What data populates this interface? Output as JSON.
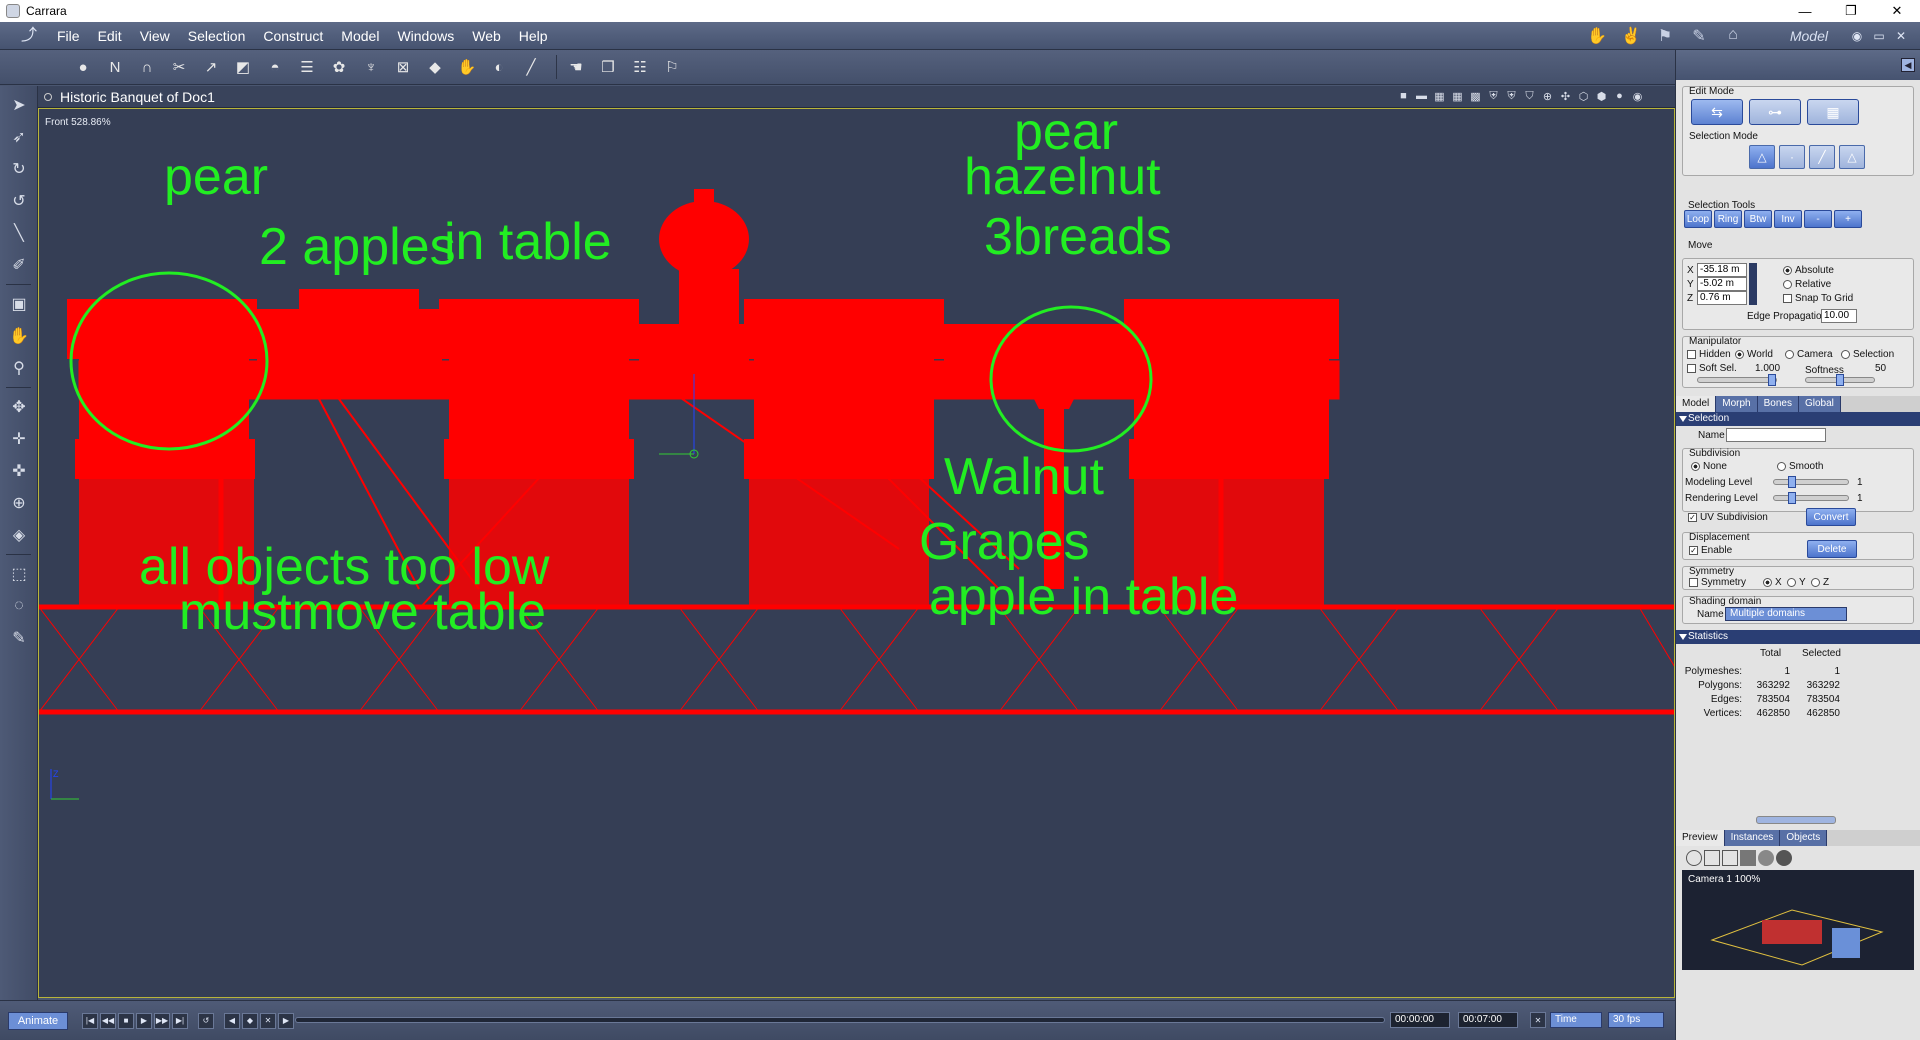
{
  "window": {
    "title": "Carrara",
    "min": "—",
    "restore": "❐",
    "close": "✕"
  },
  "menubar": {
    "items": [
      "File",
      "Edit",
      "View",
      "Selection",
      "Construct",
      "Model",
      "Windows",
      "Web",
      "Help"
    ],
    "room_name": "Model"
  },
  "viewport": {
    "doc_title": "Historic  Banquet of Doc1",
    "camera_label": "Front 528.86%"
  },
  "annotations": {
    "left_top": [
      "pear",
      "2 apples",
      "in table"
    ],
    "left_bottom": [
      "all objects too low",
      "mustmove table"
    ],
    "right_top": [
      "pear",
      "hazelnut",
      "3breads"
    ],
    "right_bottom": [
      "Walnut",
      "Grapes",
      "apple in table"
    ]
  },
  "timeline": {
    "animate_label": "Animate",
    "current_time": "00:00:00",
    "end_time": "00:07:00",
    "time_mode": "Time",
    "fps": "30 fps"
  },
  "panel": {
    "edit_mode_label": "Edit Mode",
    "selection_mode_label": "Selection Mode",
    "selection_tools_label": "Selection Tools",
    "selection_tools": [
      "Loop",
      "Ring",
      "Btw",
      "Inv",
      "-",
      "+"
    ],
    "move_label": "Move",
    "x_label": "X",
    "x_value": "-35.18 m",
    "y_label": "Y",
    "y_value": "-5.02 m",
    "z_label": "Z",
    "z_value": "0.76 m",
    "absolute": "Absolute",
    "relative": "Relative",
    "snap_to_grid": "Snap To Grid",
    "edge_propagation_label": "Edge Propagation",
    "edge_propagation_value": "10.00",
    "manipulator_label": "Manipulator",
    "hidden": "Hidden",
    "world": "World",
    "camera": "Camera",
    "selection": "Selection",
    "soft_sel": "Soft Sel.",
    "soft_sel_value": "1.000",
    "softness": "Softness",
    "softness_value": "50",
    "tabs": [
      "Model",
      "Morph",
      "Bones",
      "Global"
    ],
    "selection_section": "Selection",
    "name_label": "Name",
    "subdivision_label": "Subdivision",
    "none": "None",
    "smooth": "Smooth",
    "modeling_level": "Modeling Level",
    "modeling_level_value": "1",
    "rendering_level": "Rendering Level",
    "rendering_level_value": "1",
    "uv_subdivision": "UV Subdivision",
    "convert": "Convert",
    "displacement_label": "Displacement",
    "enable": "Enable",
    "delete": "Delete",
    "symmetry_label": "Symmetry",
    "symmetry": "Symmetry",
    "sym_x": "X",
    "sym_y": "Y",
    "sym_z": "Z",
    "shading_domain_label": "Shading domain",
    "shading_name_label": "Name",
    "shading_value": "Multiple domains",
    "statistics_section": "Statistics",
    "total": "Total",
    "selected": "Selected",
    "stats": [
      {
        "label": "Polymeshes:",
        "total": "1",
        "selected": "1"
      },
      {
        "label": "Polygons:",
        "total": "363292",
        "selected": "363292"
      },
      {
        "label": "Edges:",
        "total": "783504",
        "selected": "783504"
      },
      {
        "label": "Vertices:",
        "total": "462850",
        "selected": "462850"
      }
    ],
    "bottom_tabs": [
      "Preview",
      "Instances",
      "Objects"
    ],
    "preview_label": "Camera 1 100%"
  },
  "colors": {
    "wireframe": "#ff0000",
    "annotation": "#22ee22",
    "viewport_bg": "#353e55",
    "accent": "#5d82d2"
  }
}
